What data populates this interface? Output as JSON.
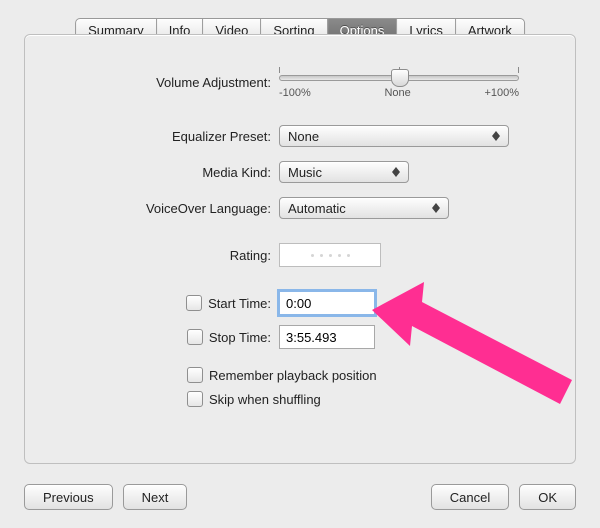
{
  "tabs": {
    "items": [
      "Summary",
      "Info",
      "Video",
      "Sorting",
      "Options",
      "Lyrics",
      "Artwork"
    ],
    "selected_index": 4
  },
  "volume": {
    "label": "Volume Adjustment:",
    "min_label": "-100%",
    "center_label": "None",
    "max_label": "+100%",
    "value_percent": 0
  },
  "equalizer": {
    "label": "Equalizer Preset:",
    "value": "None"
  },
  "media_kind": {
    "label": "Media Kind:",
    "value": "Music"
  },
  "voiceover": {
    "label": "VoiceOver Language:",
    "value": "Automatic"
  },
  "rating": {
    "label": "Rating:",
    "stars": 0
  },
  "start_time": {
    "label": "Start Time:",
    "checked": false,
    "value": "0:00"
  },
  "stop_time": {
    "label": "Stop Time:",
    "checked": false,
    "value": "3:55.493"
  },
  "remember_position": {
    "label": "Remember playback position",
    "checked": false
  },
  "skip_shuffle": {
    "label": "Skip when shuffling",
    "checked": false
  },
  "buttons": {
    "previous": "Previous",
    "next": "Next",
    "cancel": "Cancel",
    "ok": "OK"
  }
}
